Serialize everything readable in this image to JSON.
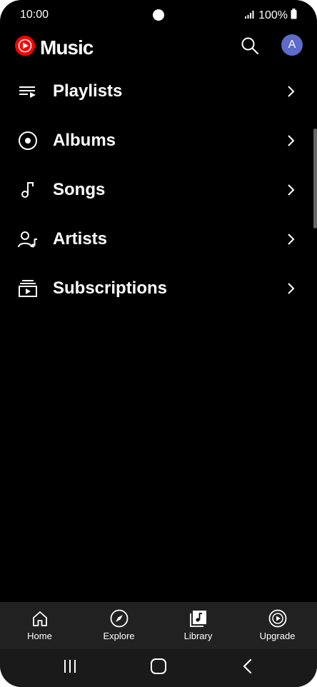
{
  "status_bar": {
    "time": "10:00",
    "battery": "100%"
  },
  "header": {
    "app_name": "Music",
    "avatar_initial": "A"
  },
  "library": {
    "items": [
      {
        "label": "Playlists",
        "icon": "playlist-icon"
      },
      {
        "label": "Albums",
        "icon": "album-icon"
      },
      {
        "label": "Songs",
        "icon": "music-note-icon"
      },
      {
        "label": "Artists",
        "icon": "artist-icon"
      },
      {
        "label": "Subscriptions",
        "icon": "subscriptions-icon"
      }
    ]
  },
  "bottom_nav": {
    "items": [
      {
        "label": "Home",
        "icon": "home-icon"
      },
      {
        "label": "Explore",
        "icon": "compass-icon"
      },
      {
        "label": "Library",
        "icon": "library-icon"
      },
      {
        "label": "Upgrade",
        "icon": "upgrade-icon"
      }
    ]
  },
  "colors": {
    "background": "#000000",
    "nav_background": "#212121",
    "brand_red": "#ff0000",
    "avatar": "#5e6bc9"
  }
}
